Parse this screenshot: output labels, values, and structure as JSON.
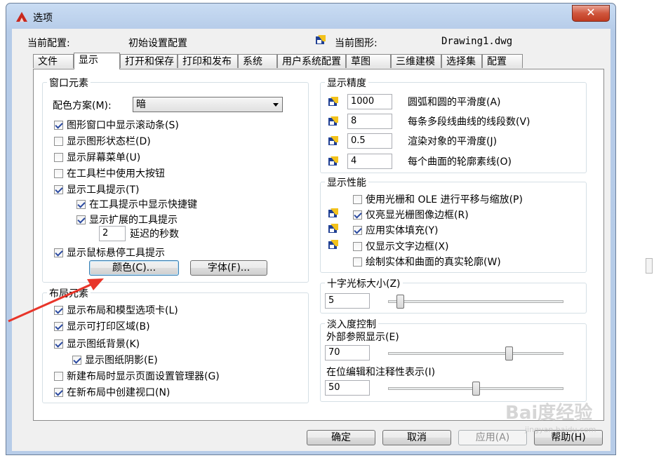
{
  "window": {
    "title": "选项",
    "close_glyph": "✕"
  },
  "header": {
    "current_profile_label": "当前配置:",
    "current_profile_value": "初始设置配置",
    "current_drawing_label": "当前图形:",
    "current_drawing_value": "Drawing1.dwg"
  },
  "tabs": [
    "文件",
    "显示",
    "打开和保存",
    "打印和发布",
    "系统",
    "用户系统配置",
    "草图",
    "三维建模",
    "选择集",
    "配置"
  ],
  "active_tab": "显示",
  "window_elements": {
    "title": "窗口元素",
    "color_scheme_label": "配色方案(M):",
    "color_scheme_value": "暗",
    "checkboxes": [
      {
        "label": "图形窗口中显示滚动条(S)",
        "checked": true
      },
      {
        "label": "显示图形状态栏(D)",
        "checked": false
      },
      {
        "label": "显示屏幕菜单(U)",
        "checked": false
      },
      {
        "label": "在工具栏中使用大按钮",
        "checked": false
      },
      {
        "label": "显示工具提示(T)",
        "checked": true
      },
      {
        "label": "在工具提示中显示快捷键",
        "checked": true
      },
      {
        "label": "显示扩展的工具提示",
        "checked": true
      },
      {
        "label": "显示鼠标悬停工具提示",
        "checked": true
      }
    ],
    "delay_value": "2",
    "delay_label": "延迟的秒数",
    "colors_button": "颜色(C)...",
    "fonts_button": "字体(F)..."
  },
  "layout_elements": {
    "title": "布局元素",
    "checkboxes": [
      {
        "label": "显示布局和模型选项卡(L)",
        "checked": true
      },
      {
        "label": "显示可打印区域(B)",
        "checked": true
      },
      {
        "label": "显示图纸背景(K)",
        "checked": true
      },
      {
        "label": "显示图纸阴影(E)",
        "checked": true
      },
      {
        "label": "新建布局时显示页面设置管理器(G)",
        "checked": false
      },
      {
        "label": "在新布局中创建视口(N)",
        "checked": true
      }
    ]
  },
  "display_resolution": {
    "title": "显示精度",
    "rows": [
      {
        "value": "1000",
        "label": "圆弧和圆的平滑度(A)"
      },
      {
        "value": "8",
        "label": "每条多段线曲线的线段数(V)"
      },
      {
        "value": "0.5",
        "label": "渲染对象的平滑度(J)"
      },
      {
        "value": "4",
        "label": "每个曲面的轮廓素线(O)"
      }
    ]
  },
  "display_performance": {
    "title": "显示性能",
    "checkboxes": [
      {
        "label": "使用光栅和 OLE 进行平移与缩放(P)",
        "checked": false
      },
      {
        "label": "仅亮显光栅图像边框(R)",
        "checked": true
      },
      {
        "label": "应用实体填充(Y)",
        "checked": true
      },
      {
        "label": "仅显示文字边框(X)",
        "checked": false
      },
      {
        "label": "绘制实体和曲面的真实轮廓(W)",
        "checked": false
      }
    ]
  },
  "crosshair": {
    "title": "十字光标大小(Z)",
    "value": "5",
    "slider_fraction": 0.05
  },
  "fade": {
    "title": "淡入度控制",
    "xref_label": "外部参照显示(E)",
    "xref_value": "70",
    "xref_fraction": 0.7,
    "inplace_label": "在位编辑和注释性表示(I)",
    "inplace_value": "50",
    "inplace_fraction": 0.5
  },
  "buttons": {
    "ok": "确定",
    "cancel": "取消",
    "apply": "应用(A)",
    "help": "帮助(H)"
  },
  "watermark": {
    "brand": "Bai度经验",
    "url": "jingyan.baidu.com"
  }
}
